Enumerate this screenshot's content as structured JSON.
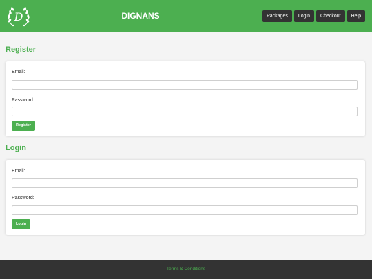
{
  "header": {
    "brand": "DIGNANS",
    "logo_letter": "D",
    "nav": [
      {
        "label": "Packages"
      },
      {
        "label": "Login"
      },
      {
        "label": "Checkout"
      },
      {
        "label": "Help"
      }
    ]
  },
  "register": {
    "title": "Register",
    "email_label": "Email:",
    "email_value": "",
    "password_label": "Password:",
    "password_value": "",
    "button_label": "Register"
  },
  "login": {
    "title": "Login",
    "email_label": "Email:",
    "email_value": "",
    "password_label": "Password:",
    "password_value": "",
    "button_label": "Login"
  },
  "footer": {
    "link_label": "Terms & Conditions"
  },
  "colors": {
    "accent": "#4caf50",
    "dark": "#333333",
    "background": "#f4f4f4"
  }
}
